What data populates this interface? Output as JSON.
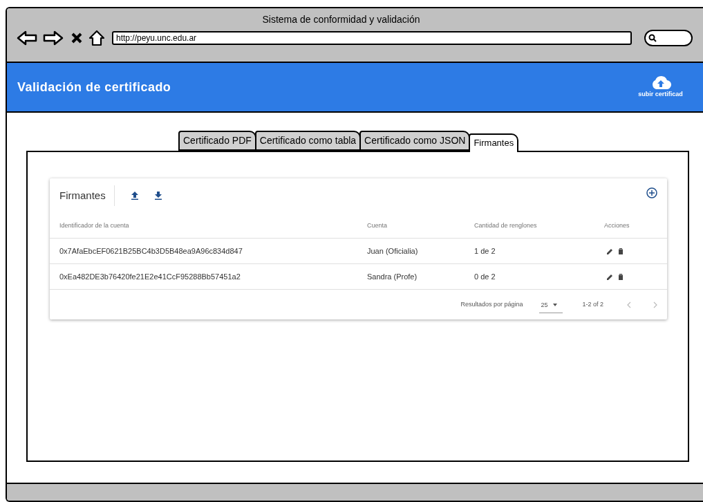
{
  "window": {
    "title": "Sistema de conformidad y validación",
    "url": "http://peyu.unc.edu.ar"
  },
  "header": {
    "title": "Validación de certificado",
    "upload_label": "subir certificad"
  },
  "tabs": [
    {
      "label": "Certificado PDF",
      "selected": false
    },
    {
      "label": "Certificado como tabla",
      "selected": false
    },
    {
      "label": "Certificado como JSON",
      "selected": false
    },
    {
      "label": "Firmantes",
      "selected": true
    }
  ],
  "table": {
    "title": "Firmantes",
    "columns": [
      "Identificador de la cuenta",
      "Cuenta",
      "Cantidad de renglones",
      "Acciones"
    ],
    "rows": [
      {
        "id": "0x7AfaEbcEF0621B25BC4b3D5B48ea9A96c834d847",
        "account": "Juan (Oficialia)",
        "lines": "1 de 2"
      },
      {
        "id": "0xEa482DE3b76420fe21E2e41CcF95288Bb57451a2",
        "account": "Sandra (Profe)",
        "lines": "0 de 2"
      }
    ],
    "pagination": {
      "label": "Resultados por página",
      "per_page": "25",
      "range": "1-2 of 2"
    }
  }
}
